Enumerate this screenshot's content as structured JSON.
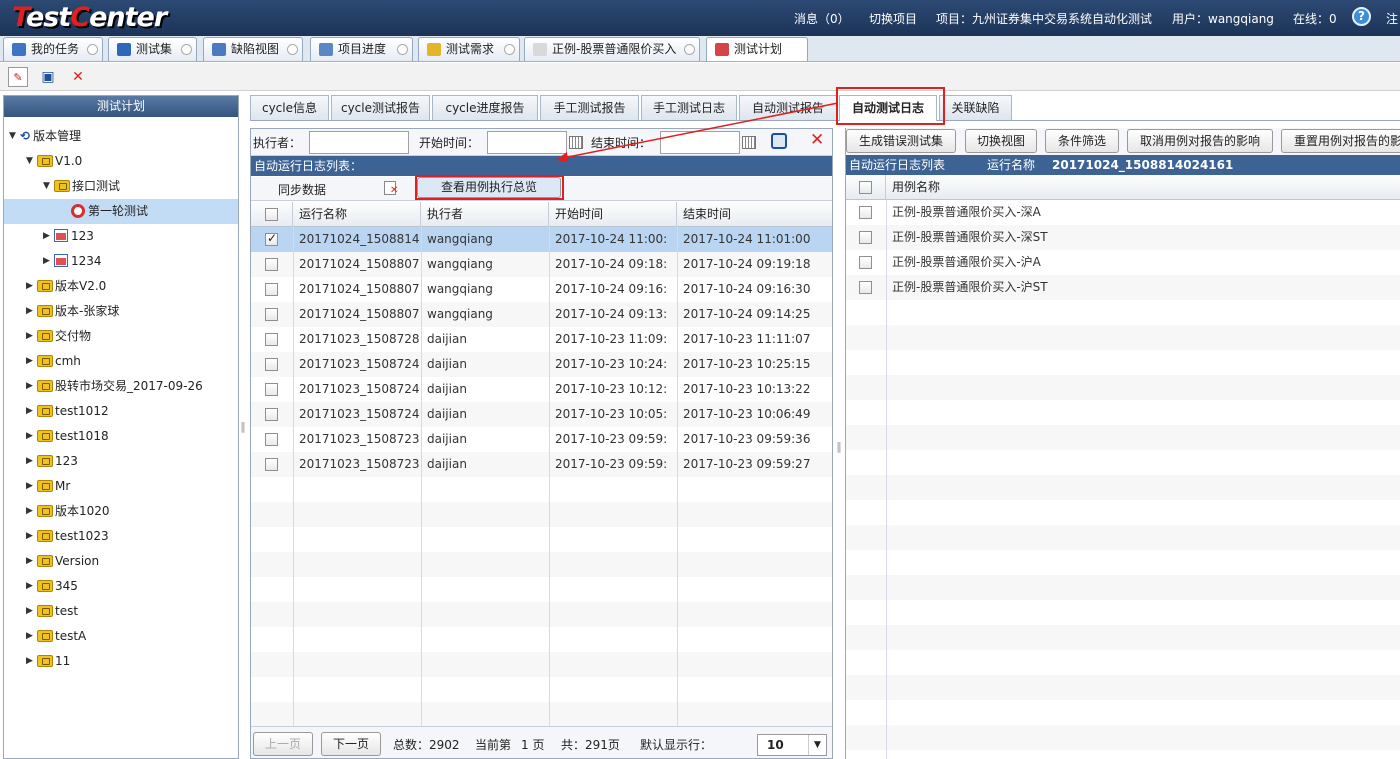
{
  "header": {
    "logo_prefix": "T",
    "logo_mid": "est",
    "logo_c": "C",
    "logo_suffix": "enter",
    "messages": "消息（0）",
    "switch_project": "切换项目",
    "project": "项目：九州证券集中交易系统自动化测试",
    "user": "用户：wangqiang",
    "online": "在线：0",
    "help": "?",
    "tail": "注"
  },
  "top_tabs": [
    {
      "label": "我的任务",
      "icon_color": "#3f74c4"
    },
    {
      "label": "测试集",
      "icon_color": "#2f68b8"
    },
    {
      "label": "缺陷视图",
      "icon_color": "#4a7ac0"
    },
    {
      "label": "项目进度",
      "icon_color": "#5b86c6"
    },
    {
      "label": "测试需求",
      "icon_color": "#e2b52a"
    },
    {
      "label": "正例-股票普通限价买入",
      "icon_color": "#d9d9d9"
    },
    {
      "label": "测试计划",
      "icon_color": "#d64545"
    }
  ],
  "toolbar": {
    "new_icon": "✎",
    "save_icon": "▣",
    "delete_icon": "✕"
  },
  "left_panel": {
    "title": "测试计划",
    "tree": [
      {
        "label": "版本管理",
        "level": 0,
        "toggle": "▼",
        "icon": "root"
      },
      {
        "label": "V1.0",
        "level": 1,
        "toggle": "▼",
        "icon": "folder"
      },
      {
        "label": "接口测试",
        "level": 2,
        "toggle": "▼",
        "icon": "folder"
      },
      {
        "label": "第一轮测试",
        "level": 3,
        "toggle": "",
        "icon": "cycle",
        "selected": true
      },
      {
        "label": "123",
        "level": 2,
        "toggle": "▶",
        "icon": "calendar"
      },
      {
        "label": "1234",
        "level": 2,
        "toggle": "▶",
        "icon": "calendar"
      },
      {
        "label": "版本V2.0",
        "level": 1,
        "toggle": "▶",
        "icon": "folder"
      },
      {
        "label": "版本-张家球",
        "level": 1,
        "toggle": "▶",
        "icon": "folder"
      },
      {
        "label": "交付物",
        "level": 1,
        "toggle": "▶",
        "icon": "folder"
      },
      {
        "label": "cmh",
        "level": 1,
        "toggle": "▶",
        "icon": "folder"
      },
      {
        "label": "股转市场交易_2017-09-26",
        "level": 1,
        "toggle": "▶",
        "icon": "folder"
      },
      {
        "label": "test1012",
        "level": 1,
        "toggle": "▶",
        "icon": "folder"
      },
      {
        "label": "test1018",
        "level": 1,
        "toggle": "▶",
        "icon": "folder"
      },
      {
        "label": "123",
        "level": 1,
        "toggle": "▶",
        "icon": "folder"
      },
      {
        "label": "Mr",
        "level": 1,
        "toggle": "▶",
        "icon": "folder"
      },
      {
        "label": "版本1020",
        "level": 1,
        "toggle": "▶",
        "icon": "folder"
      },
      {
        "label": "test1023",
        "level": 1,
        "toggle": "▶",
        "icon": "folder"
      },
      {
        "label": "Version",
        "level": 1,
        "toggle": "▶",
        "icon": "folder"
      },
      {
        "label": "345",
        "level": 1,
        "toggle": "▶",
        "icon": "folder"
      },
      {
        "label": "test",
        "level": 1,
        "toggle": "▶",
        "icon": "folder"
      },
      {
        "label": "testA",
        "level": 1,
        "toggle": "▶",
        "icon": "folder"
      },
      {
        "label": "11",
        "level": 1,
        "toggle": "▶",
        "icon": "folder"
      }
    ]
  },
  "content_tabs": [
    "cycle信息",
    "cycle测试报告",
    "cycle进度报告",
    "手工测试报告",
    "手工测试日志",
    "自动测试报告",
    "自动测试日志",
    "关联缺陷"
  ],
  "active_tab": "自动测试日志",
  "filter": {
    "executor_label": "执行者：",
    "start_label": "开始时间：",
    "end_label": "结束时间：",
    "executor_value": "",
    "start_value": "",
    "end_value": ""
  },
  "list_title": "自动运行日志列表：",
  "actions": {
    "sync": "同步数据",
    "view_summary": "查看用例执行总览"
  },
  "grid": {
    "columns": [
      "运行名称",
      "执行者",
      "开始时间",
      "结束时间"
    ],
    "rows": [
      {
        "name": "20171024_1508814",
        "executor": "wangqiang",
        "start": "2017-10-24 11:00:",
        "end": "2017-10-24 11:01:00",
        "checked": true
      },
      {
        "name": "20171024_1508807",
        "executor": "wangqiang",
        "start": "2017-10-24 09:18:",
        "end": "2017-10-24 09:19:18",
        "checked": false
      },
      {
        "name": "20171024_1508807",
        "executor": "wangqiang",
        "start": "2017-10-24 09:16:",
        "end": "2017-10-24 09:16:30",
        "checked": false
      },
      {
        "name": "20171024_1508807",
        "executor": "wangqiang",
        "start": "2017-10-24 09:13:",
        "end": "2017-10-24 09:14:25",
        "checked": false
      },
      {
        "name": "20171023_1508728",
        "executor": "daijian",
        "start": "2017-10-23 11:09:",
        "end": "2017-10-23 11:11:07",
        "checked": false
      },
      {
        "name": "20171023_1508724",
        "executor": "daijian",
        "start": "2017-10-23 10:24:",
        "end": "2017-10-23 10:25:15",
        "checked": false
      },
      {
        "name": "20171023_1508724",
        "executor": "daijian",
        "start": "2017-10-23 10:12:",
        "end": "2017-10-23 10:13:22",
        "checked": false
      },
      {
        "name": "20171023_1508724",
        "executor": "daijian",
        "start": "2017-10-23 10:05:",
        "end": "2017-10-23 10:06:49",
        "checked": false
      },
      {
        "name": "20171023_1508723",
        "executor": "daijian",
        "start": "2017-10-23 09:59:",
        "end": "2017-10-23 09:59:36",
        "checked": false
      },
      {
        "name": "20171023_1508723",
        "executor": "daijian",
        "start": "2017-10-23 09:59:",
        "end": "2017-10-23 09:59:27",
        "checked": false
      }
    ]
  },
  "pager": {
    "prev": "上一页",
    "next": "下一页",
    "total": "总数：2902",
    "current": "当前第",
    "current_num": "1 页",
    "pages": "共：291页",
    "page_size_label": "默认显示行：",
    "page_size": "10"
  },
  "right": {
    "buttons": [
      "生成错误测试集",
      "切换视图",
      "条件筛选",
      "取消用例对报告的影响",
      "重置用例对报告的影响"
    ],
    "bar_label": "自动运行日志列表",
    "run_label": "运行名称",
    "run_value": "20171024_1508814024161",
    "column": "用例名称",
    "cases": [
      "正例-股票普通限价买入-深A",
      "正例-股票普通限价买入-深ST",
      "正例-股票普通限价买入-沪A",
      "正例-股票普通限价买入-沪ST"
    ]
  }
}
